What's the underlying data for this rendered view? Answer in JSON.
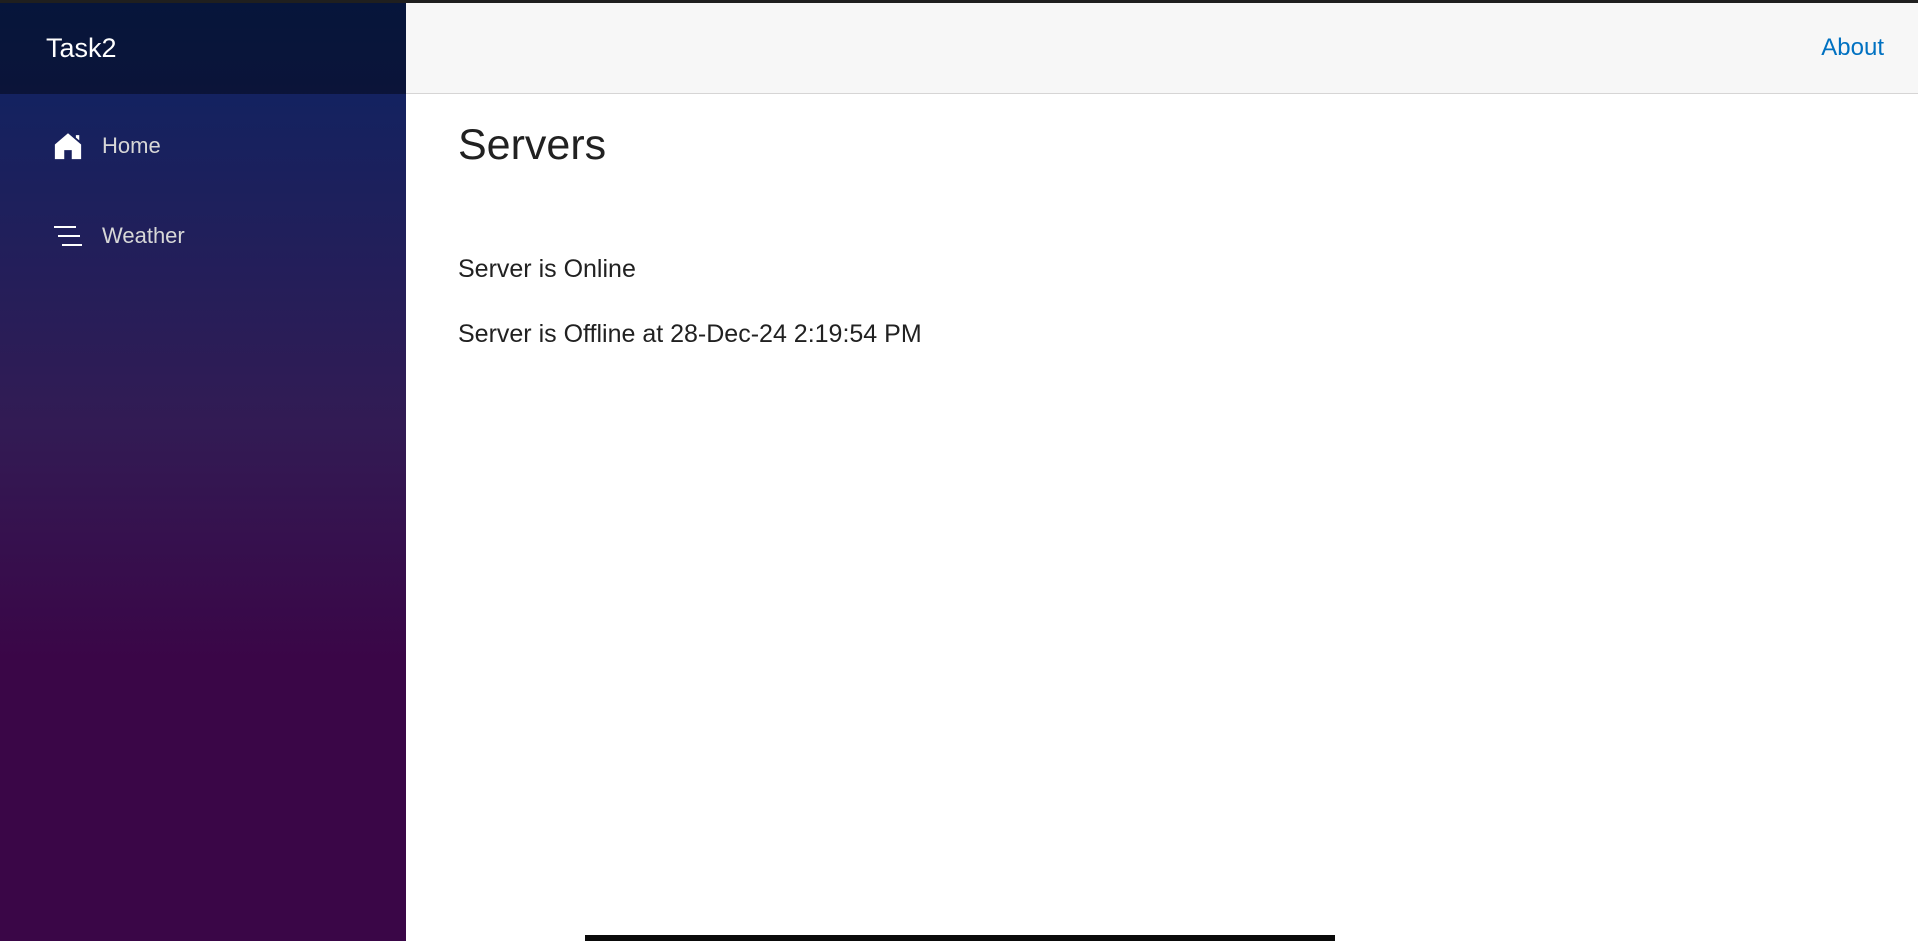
{
  "sidebar": {
    "brand": "Task2",
    "items": [
      {
        "label": "Home",
        "icon": "home-icon"
      },
      {
        "label": "Weather",
        "icon": "list-icon"
      }
    ]
  },
  "header": {
    "about_label": "About"
  },
  "main": {
    "title": "Servers",
    "status_online": "Server is Online",
    "status_offline": "Server is Offline at 28-Dec-24 2:19:54 PM"
  },
  "colors": {
    "link": "#0071c1",
    "sidebar_top": "#0b2463",
    "sidebar_bottom": "#3a0647"
  }
}
